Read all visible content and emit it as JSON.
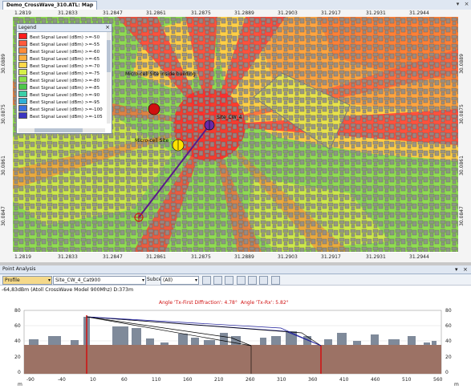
{
  "window": {
    "tab_title": "Demo_CrossWave_310.ATL: Map",
    "controls": {
      "pin": "▾",
      "close": "×"
    }
  },
  "map": {
    "x_ticks": [
      "1.2819",
      "31.2833",
      "31.2847",
      "31.2861",
      "31.2875",
      "31.2889",
      "31.2903",
      "31.2917",
      "31.2931",
      "31.2944"
    ],
    "y_ticks": [
      "30.0889",
      "30.0875",
      "30.0861",
      "30.0847"
    ],
    "legend": {
      "title": "Legend",
      "items": [
        {
          "label": "Best Signal Level (dBm) >=-50",
          "color": "#ff1c1c"
        },
        {
          "label": "Best Signal Level (dBm) >=-55",
          "color": "#ff5a3c"
        },
        {
          "label": "Best Signal Level (dBm) >=-60",
          "color": "#ff8c3a"
        },
        {
          "label": "Best Signal Level (dBm) >=-65",
          "color": "#ffb040"
        },
        {
          "label": "Best Signal Level (dBm) >=-70",
          "color": "#ffd84a"
        },
        {
          "label": "Best Signal Level (dBm) >=-75",
          "color": "#d6ef4a"
        },
        {
          "label": "Best Signal Level (dBm) >=-80",
          "color": "#8ae04a"
        },
        {
          "label": "Best Signal Level (dBm) >=-85",
          "color": "#4cc84a"
        },
        {
          "label": "Best Signal Level (dBm) >=-90",
          "color": "#3ccfa8"
        },
        {
          "label": "Best Signal Level (dBm) >=-95",
          "color": "#2fb0d6"
        },
        {
          "label": "Best Signal Level (dBm) >=-100",
          "color": "#3a6ee0"
        },
        {
          "label": "Best Signal Level (dBm) >=-105",
          "color": "#3a34c0"
        }
      ]
    },
    "sites": [
      {
        "label": "Micro-cell Site inside building"
      },
      {
        "label": "Site_CW_4"
      },
      {
        "label": "Micro-cell Site"
      }
    ]
  },
  "point_analysis": {
    "title": "Point Analysis",
    "mode": "Profile",
    "transmitter": "Site_CW_4_Cat900",
    "subcell_label": "Subcell:",
    "subcell_value": "(All)",
    "info": "-64,83dBm (Atoll CrossWave Model 900Mhz) D:373m",
    "angle_diffraction": "Angle 'Tx-First Diffraction': 4.78°",
    "angle_txrx": "Angle 'Tx-Rx': 5.82°",
    "y_ticks": [
      "80",
      "60",
      "40",
      "20",
      "0"
    ],
    "x_ticks": [
      "-90",
      "-40",
      "10",
      "60",
      "110",
      "160",
      "210",
      "260",
      "310",
      "360",
      "410",
      "460",
      "510",
      "560"
    ],
    "x_unit": "m",
    "y_unit": "m"
  }
}
